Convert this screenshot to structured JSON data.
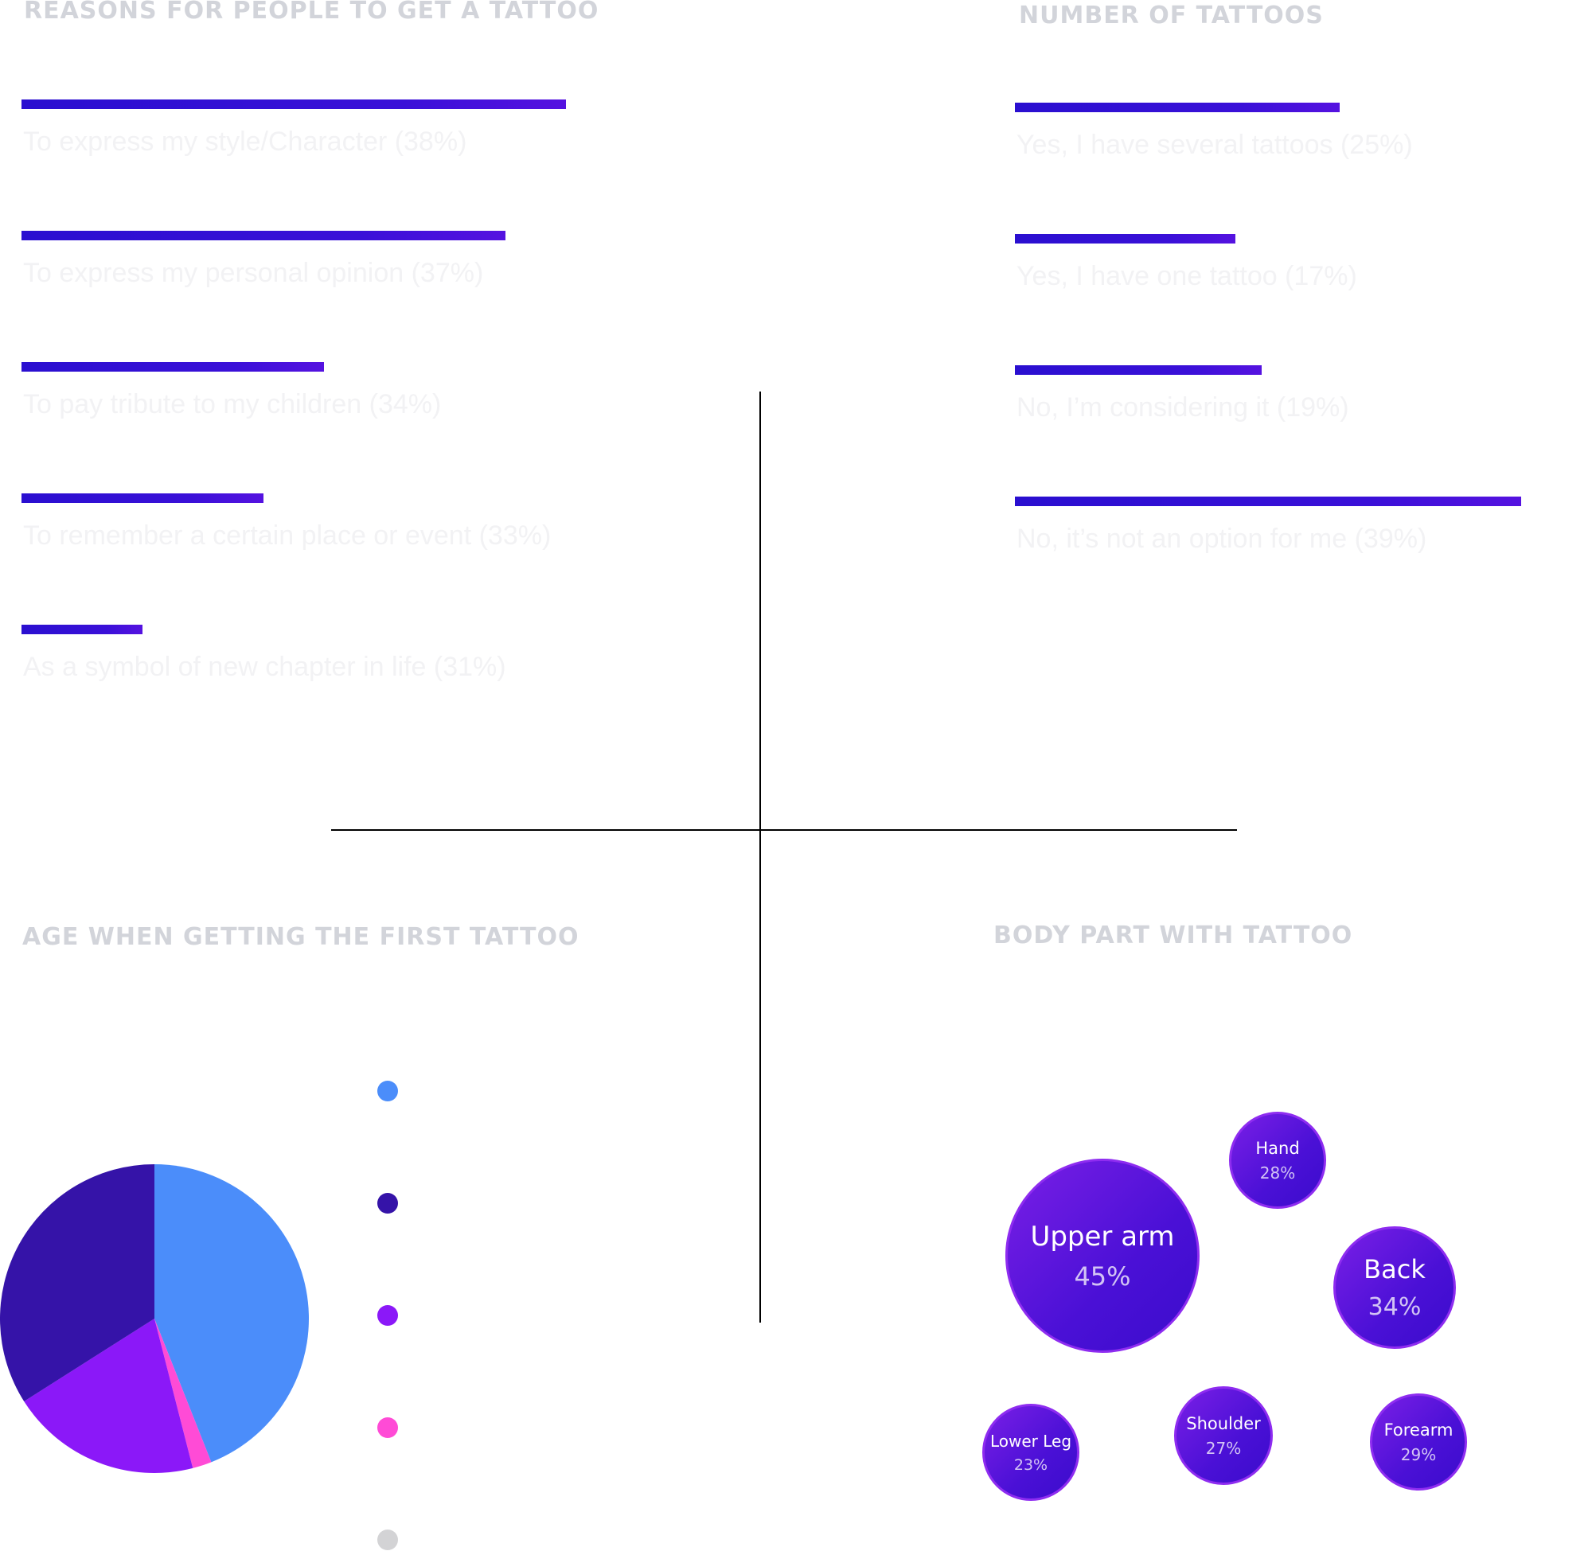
{
  "chart_data": [
    {
      "type": "bar",
      "title": "REASONS FOR PEOPLE TO GET A TATTOO",
      "categories": [
        "To express my style/Character (38%)",
        "To express my personal opinion (37%)",
        "To pay tribute to my children (34%)",
        "To remember a certain place or event (33%)",
        "As a symbol of new chapter in life (31%)"
      ],
      "values": [
        38,
        37,
        34,
        33,
        31
      ],
      "orientation": "horizontal"
    },
    {
      "type": "bar",
      "title": "NUMBER OF TATTOOS",
      "categories": [
        "Yes, I have several tattoos (25%)",
        "Yes, I have one tattoo (17%)",
        "No, I’m considering it (19%)",
        "No, it’s not an option for me (39%)"
      ],
      "values": [
        25,
        17,
        19,
        39
      ],
      "orientation": "horizontal"
    },
    {
      "type": "pie",
      "title": "AGE WHEN GETTING THE FIRST TATTOO",
      "slices": [
        {
          "label": "",
          "value": 44,
          "color": "#4b8dfa"
        },
        {
          "label": "",
          "value": 2,
          "color": "#ff4bd6"
        },
        {
          "label": "",
          "value": 20,
          "color": "#8b18f8"
        },
        {
          "label": "",
          "value": 34,
          "color": "#3513a8"
        }
      ],
      "legend": [
        {
          "label": "",
          "color": "#4b8dfa"
        },
        {
          "label": "",
          "color": "#3513a8"
        },
        {
          "label": "",
          "color": "#8b18f8"
        },
        {
          "label": "",
          "color": "#ff4bd6"
        },
        {
          "label": "",
          "color": "#d3d3d5"
        }
      ],
      "legend_position": "right"
    },
    {
      "type": "bubble",
      "title": "BODY PART WITH TATTOO",
      "points": [
        {
          "name": "Upper arm",
          "value": 45,
          "label": "45%"
        },
        {
          "name": "Hand",
          "value": 28,
          "label": "28%"
        },
        {
          "name": "Back",
          "value": 34,
          "label": "34%"
        },
        {
          "name": "Lower Leg",
          "value": 23,
          "label": "23%"
        },
        {
          "name": "Shoulder",
          "value": 27,
          "label": "27%"
        },
        {
          "name": "Forearm",
          "value": 29,
          "label": "29%"
        }
      ]
    }
  ]
}
